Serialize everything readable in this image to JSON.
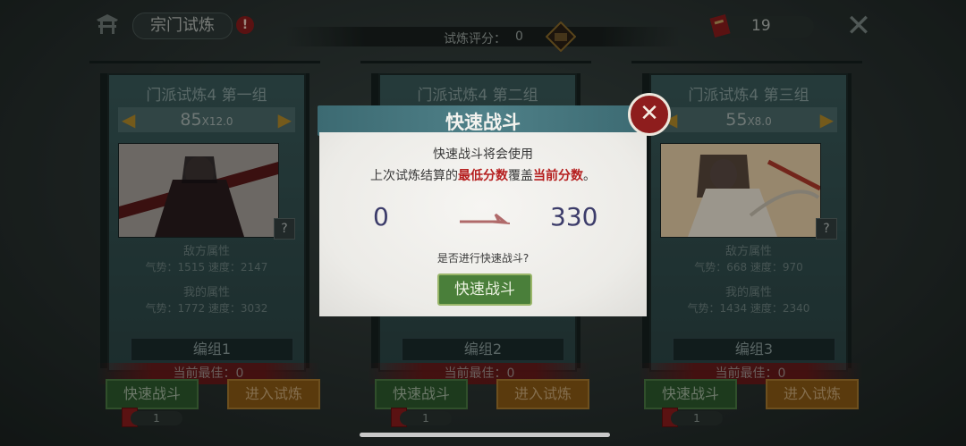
{
  "topbar": {
    "title": "宗门试炼",
    "alert": "!",
    "score_label": "试炼评分：",
    "score_value": "0",
    "ticket_count": "19",
    "close_glyph": "✕"
  },
  "panels": [
    {
      "title": "门派试炼4  第一组",
      "level": "85",
      "multiplier": "X12.0",
      "enemy_header": "敌方属性",
      "enemy_stats": "气势：1515  速度：2147",
      "mine_header": "我的属性",
      "mine_stats": "气势：1772  速度：3032",
      "group": "编组1",
      "best": "当前最佳：0",
      "quick": "快速战斗",
      "enter": "进入试炼",
      "ticket": "1"
    },
    {
      "title": "门派试炼4  第二组",
      "level": "",
      "multiplier": "",
      "enemy_header": "",
      "enemy_stats": "",
      "mine_header": "",
      "mine_stats": "",
      "group": "编组2",
      "best": "当前最佳：0",
      "quick": "快速战斗",
      "enter": "进入试炼",
      "ticket": "1"
    },
    {
      "title": "门派试炼4  第三组",
      "level": "55",
      "multiplier": "X8.0",
      "enemy_header": "敌方属性",
      "enemy_stats": "气势：668  速度：970",
      "mine_header": "我的属性",
      "mine_stats": "气势：1434  速度：2340",
      "group": "编组3",
      "best": "当前最佳：0",
      "quick": "快速战斗",
      "enter": "进入试炼",
      "ticket": "1"
    }
  ],
  "dialog": {
    "title": "快速战斗",
    "line1": "快速战斗将会使用",
    "line2_a": "上次试炼结算的",
    "line2_red1": "最低分数",
    "line2_b": "覆盖",
    "line2_red2": "当前分数",
    "line2_c": "。",
    "from_score": "0",
    "to_score": "330",
    "question": "是否进行快速战斗?",
    "confirm": "快速战斗",
    "close_glyph": "✕"
  },
  "colors": {
    "accent_red": "#b51e1e",
    "confirm_green": "#4a7f3a",
    "dialog_header": "#4f8088"
  }
}
